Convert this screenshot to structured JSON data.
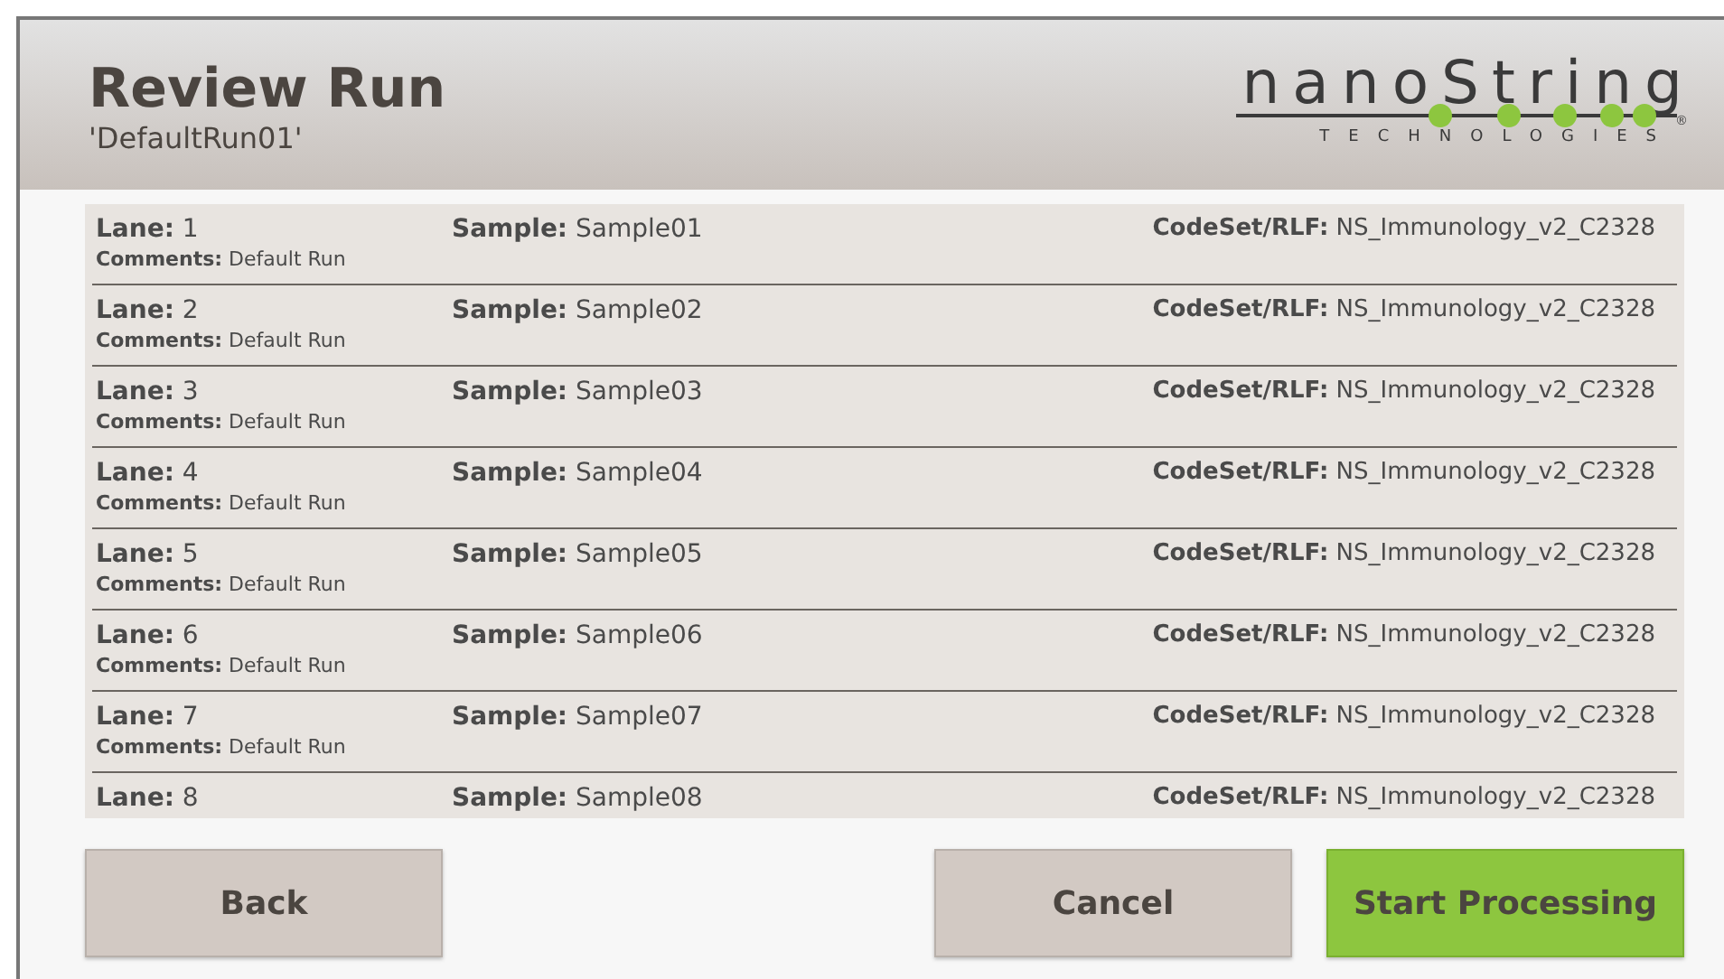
{
  "header": {
    "title": "Review Run",
    "subtitle": "'DefaultRun01'",
    "logo": {
      "wordmark": "nanoString",
      "tagline": "TECHNOLOGIES",
      "registered": "®"
    }
  },
  "lanes": [
    {
      "lane": "**Lane:** 1",
      "sample": "**Sample:** Sample01",
      "codeset": "**CodeSet/RLF:** NS_Immunology_v2_C2328",
      "comments": "**Comments:** Default Run"
    },
    {
      "lane": "**Lane:** 2",
      "sample": "**Sample:** Sample02",
      "codeset": "**CodeSet/RLF:** NS_Immunology_v2_C2328",
      "comments": "**Comments:** Default Run"
    },
    {
      "lane": "**Lane:** 3",
      "sample": "**Sample:** Sample03",
      "codeset": "**CodeSet/RLF:** NS_Immunology_v2_C2328",
      "comments": "**Comments:** Default Run"
    },
    {
      "lane": "**Lane:** 4",
      "sample": "**Sample:** Sample04",
      "codeset": "**CodeSet/RLF:** NS_Immunology_v2_C2328",
      "comments": "**Comments:** Default Run"
    },
    {
      "lane": "**Lane:** 5",
      "sample": "**Sample:** Sample05",
      "codeset": "**CodeSet/RLF:** NS_Immunology_v2_C2328",
      "comments": "**Comments:** Default Run"
    },
    {
      "lane": "**Lane:** 6",
      "sample": "**Sample:** Sample06",
      "codeset": "**CodeSet/RLF:** NS_Immunology_v2_C2328",
      "comments": "**Comments:** Default Run"
    },
    {
      "lane": "**Lane:** 7",
      "sample": "**Sample:** Sample07",
      "codeset": "**CodeSet/RLF:** NS_Immunology_v2_C2328",
      "comments": "**Comments:** Default Run"
    },
    {
      "lane": "**Lane:** 8",
      "sample": "**Sample:** Sample08",
      "codeset": "**CodeSet/RLF:** NS_Immunology_v2_C2328"
    }
  ],
  "buttons": [
    {
      "label": "Back",
      "kind": "secondary"
    },
    {
      "label": "Cancel",
      "kind": "secondary"
    },
    {
      "label": "Start Processing",
      "kind": "primary"
    }
  ]
}
